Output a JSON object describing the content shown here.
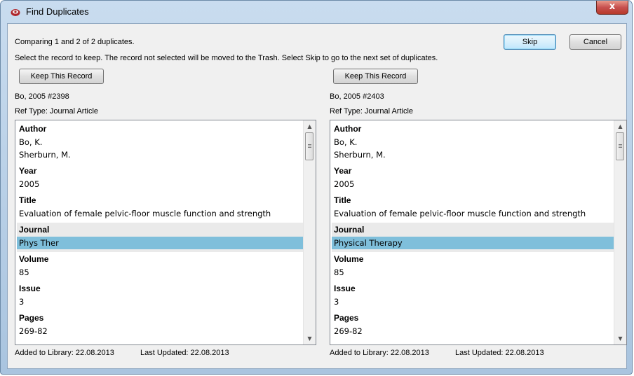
{
  "window": {
    "title": "Find Duplicates",
    "close_glyph": "x"
  },
  "header": {
    "comparing": "Comparing 1 and 2 of 2 duplicates.",
    "instructions": "Select the record to keep. The record not selected will be moved to the Trash. Select Skip to go to the next set of duplicates.",
    "skip_label": "Skip",
    "cancel_label": "Cancel"
  },
  "left": {
    "keep_label": "Keep This Record",
    "record_id": "Bo, 2005 #2398",
    "ref_type": "Ref Type: Journal Article",
    "fields": {
      "author_label": "Author",
      "author_1": "Bo, K.",
      "author_2": "Sherburn, M.",
      "year_label": "Year",
      "year": "2005",
      "title_label": "Title",
      "title": "Evaluation of female pelvic-floor muscle function and strength",
      "journal_label": "Journal",
      "journal": "Phys Ther",
      "volume_label": "Volume",
      "volume": "85",
      "issue_label": "Issue",
      "issue": "3",
      "pages_label": "Pages",
      "pages": "269-82"
    },
    "footer": {
      "added": "Added to Library: 22.08.2013",
      "updated": "Last Updated: 22.08.2013"
    }
  },
  "right": {
    "keep_label": "Keep This Record",
    "record_id": "Bo, 2005 #2403",
    "ref_type": "Ref Type: Journal Article",
    "fields": {
      "author_label": "Author",
      "author_1": "Bo, K.",
      "author_2": "Sherburn, M.",
      "year_label": "Year",
      "year": "2005",
      "title_label": "Title",
      "title": "Evaluation of female pelvic-floor muscle function and strength",
      "journal_label": "Journal",
      "journal": "Physical Therapy",
      "volume_label": "Volume",
      "volume": "85",
      "issue_label": "Issue",
      "issue": "3",
      "pages_label": "Pages",
      "pages": "269-82"
    },
    "footer": {
      "added": "Added to Library: 22.08.2013",
      "updated": "Last Updated: 22.08.2013"
    }
  },
  "colors": {
    "highlight": "#7fbfdb",
    "diff_background": "#eaeaea",
    "close_button": "#c75050"
  },
  "icons": {
    "app": "endnote-app-icon",
    "scroll_up": "scroll-up-arrow-icon",
    "scroll_down": "scroll-down-arrow-icon"
  }
}
